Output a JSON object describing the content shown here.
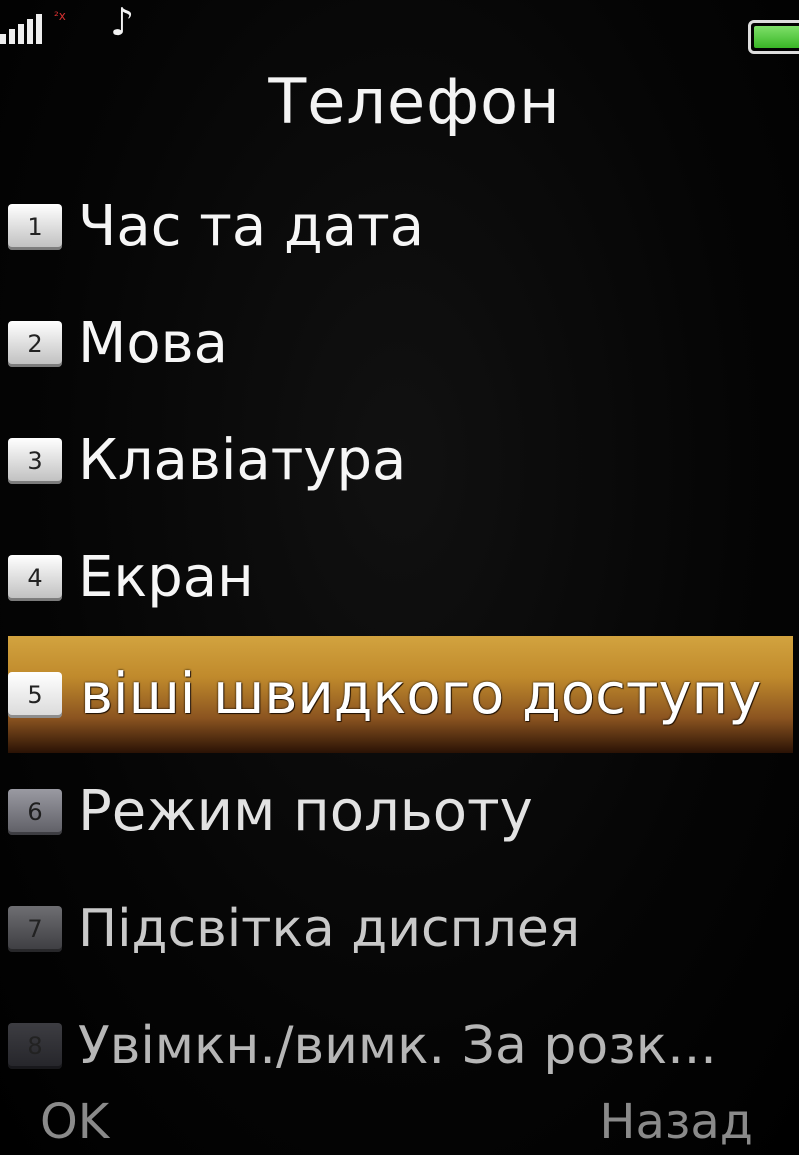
{
  "status": {
    "signal_icon": "signal-bars-icon",
    "sim2_icon": "sim-no-service-icon",
    "sim2_text": "²x",
    "music_icon": "♪",
    "battery_icon": "battery-full-icon",
    "battery_level": 1.0,
    "battery_color": "#39b526"
  },
  "title": "Телефон",
  "menu": {
    "items": [
      {
        "number": "1",
        "label": "Час та дата"
      },
      {
        "number": "2",
        "label": "Мова"
      },
      {
        "number": "3",
        "label": "Клавіатура"
      },
      {
        "number": "4",
        "label": "Екран"
      },
      {
        "number": "5",
        "label": "віші швидкого доступу"
      },
      {
        "number": "6",
        "label": "Режим польоту"
      },
      {
        "number": "7",
        "label": "Підсвітка дисплея"
      },
      {
        "number": "8",
        "label": "Увімкн./вимк. За розк..."
      }
    ],
    "selected_index": 4,
    "highlight_color": "#c08a2c"
  },
  "softkeys": {
    "left": "OK",
    "right": "Назад"
  }
}
